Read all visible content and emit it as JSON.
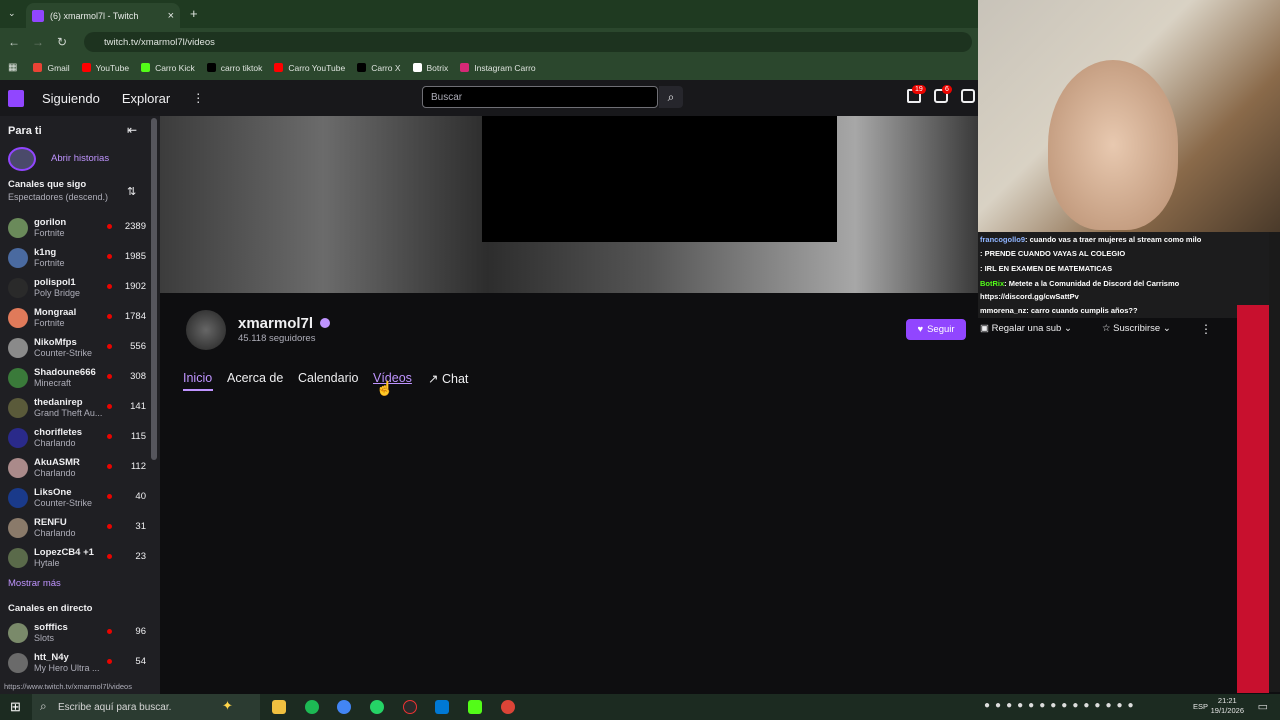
{
  "browser": {
    "tab_title": "(6) xmarmol7l - Twitch",
    "url": "twitch.tv/xmarmol7l/videos",
    "bookmarks": [
      {
        "label": "Gmail",
        "color": "#ea4335"
      },
      {
        "label": "YouTube",
        "color": "#ff0000"
      },
      {
        "label": "Carro Kick",
        "color": "#53fc18"
      },
      {
        "label": "carro tiktok",
        "color": "#000000"
      },
      {
        "label": "Carro YouTube",
        "color": "#ff0000"
      },
      {
        "label": "Carro X",
        "color": "#000000"
      },
      {
        "label": "Botrix",
        "color": "#ffffff"
      },
      {
        "label": "Instagram Carro",
        "color": "#d62976"
      }
    ]
  },
  "twitch": {
    "nav_following": "Siguiendo",
    "nav_explore": "Explorar",
    "search_placeholder": "Buscar",
    "badge_inbox": "19",
    "badge_notif": "6",
    "accent": "#9146ff"
  },
  "sidebar": {
    "title": "Para ti",
    "stories": "Abrir historias",
    "followed_title": "Canales que sigo",
    "followed_sort": "Espectadores (descend.)",
    "channels": [
      {
        "name": "gorilon",
        "game": "Fortnite",
        "viewers": "2389",
        "color": "#6a8a5a"
      },
      {
        "name": "k1ng",
        "game": "Fortnite",
        "viewers": "1985",
        "color": "#4a6aa0"
      },
      {
        "name": "polispol1",
        "game": "Poly Bridge",
        "viewers": "1902",
        "color": "#2a2a2a"
      },
      {
        "name": "Mongraal",
        "game": "Fortnite",
        "viewers": "1784",
        "color": "#e07a5a"
      },
      {
        "name": "NikoMfps",
        "game": "Counter-Strike",
        "viewers": "556",
        "color": "#8a8a8a"
      },
      {
        "name": "Shadoune666",
        "game": "Minecraft",
        "viewers": "308",
        "color": "#3a7a3a"
      },
      {
        "name": "thedanirep",
        "game": "Grand Theft Au...",
        "viewers": "141",
        "color": "#5a5a3a"
      },
      {
        "name": "chorifletes",
        "game": "Charlando",
        "viewers": "115",
        "color": "#2a2a8a"
      },
      {
        "name": "AkuASMR",
        "game": "Charlando",
        "viewers": "112",
        "color": "#aa8a8a"
      },
      {
        "name": "LiksOne",
        "game": "Counter-Strike",
        "viewers": "40",
        "color": "#1a3a8a"
      },
      {
        "name": "RENFU",
        "game": "Charlando",
        "viewers": "31",
        "color": "#8a7a6a"
      },
      {
        "name": "LopezCB4 +1",
        "game": "Hytale",
        "viewers": "23",
        "color": "#5a6a4a"
      }
    ],
    "show_more": "Mostrar más",
    "live_title": "Canales en directo",
    "live_channels": [
      {
        "name": "sofffics",
        "game": "Slots",
        "viewers": "96",
        "color": "#7a8a6a"
      },
      {
        "name": "htt_N4y",
        "game": "My Hero Ultra ...",
        "viewers": "54",
        "color": "#6a6a6a"
      }
    ]
  },
  "channel": {
    "name": "xmarmol7l",
    "followers": "45.118 seguidores",
    "follow": "Seguir",
    "gift": "Regalar una sub",
    "subscribe": "Suscribirse",
    "tabs": [
      "Inicio",
      "Acerca de",
      "Calendario",
      "Vídeos",
      "Chat"
    ]
  },
  "overlay_chat": [
    {
      "user": "francogollo9",
      "text": ": cuando vas a traer mujeres al stream como milo",
      "ucolor": "#8fb4ff"
    },
    {
      "user": "",
      "text": ": PRENDE CUANDO VAYAS AL COLEGIO",
      "ucolor": "#ff4444"
    },
    {
      "user": "",
      "text": ": IRL EN EXAMEN DE MATEMATICAS",
      "ucolor": "#ff4444"
    },
    {
      "user": "BotRix",
      "text": ": Metete a la Comunidad de Discord del Carrismo",
      "ucolor": "#53fc18"
    },
    {
      "user": "",
      "text": "https://discord.gg/cwSattPv",
      "ucolor": "#ffffff"
    },
    {
      "user": "mmorena_nz",
      "text": ": carro cuando cumplis años??",
      "ucolor": "#ffffff"
    }
  ],
  "status_url": "https://www.twitch.tv/xmarmol7l/videos",
  "taskbar": {
    "search": "Escribe aquí para buscar.",
    "lang": "ESP",
    "time": "21:21",
    "date": "19/1/2026"
  }
}
